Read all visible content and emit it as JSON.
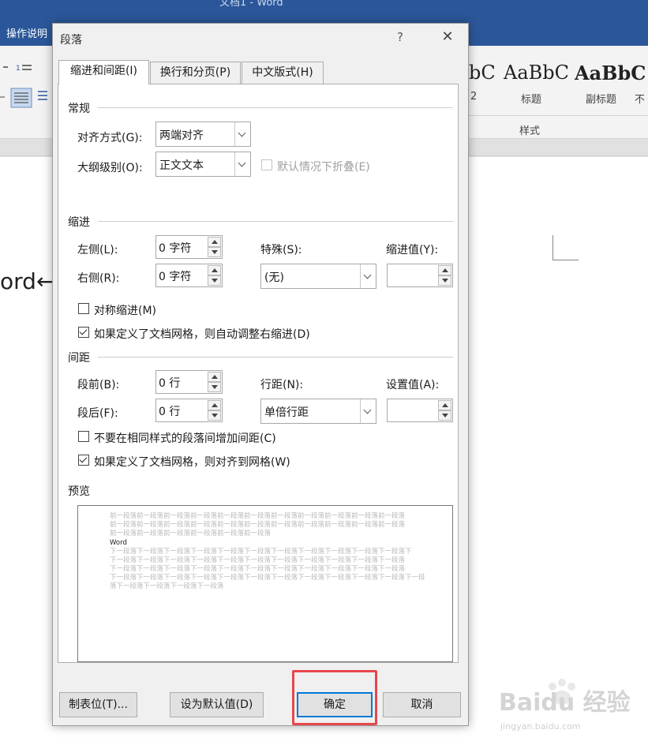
{
  "word": {
    "title_partial": "文档1 - Word",
    "tellme": "操作说明",
    "styles": [
      {
        "sample": "bC",
        "label": "2"
      },
      {
        "sample": "AaBbC",
        "label": "标题"
      },
      {
        "sample": "AaBbC",
        "label": "副标题"
      },
      {
        "sample": "",
        "label": "不"
      }
    ],
    "styles_group_label": "样式",
    "document_text": "ord←"
  },
  "dialog": {
    "title": "段落",
    "help": "?",
    "close": "✕",
    "tabs": [
      {
        "label": "缩进和间距(I)",
        "active": true
      },
      {
        "label": "换行和分页(P)",
        "active": false
      },
      {
        "label": "中文版式(H)",
        "active": false
      }
    ],
    "general": {
      "section": "常规",
      "alignment_label": "对齐方式(G):",
      "alignment_value": "两端对齐",
      "outline_label": "大纲级别(O):",
      "outline_value": "正文文本",
      "collapse_label": "默认情况下折叠(E)"
    },
    "indent": {
      "section": "缩进",
      "left_label": "左侧(L):",
      "left_value": "0 字符",
      "right_label": "右侧(R):",
      "right_value": "0 字符",
      "special_label": "特殊(S):",
      "special_value": "(无)",
      "by_label": "缩进值(Y):",
      "by_value": "",
      "mirror_label": "对称缩进(M)",
      "mirror_checked": false,
      "auto_adjust_label": "如果定义了文档网格，则自动调整右缩进(D)",
      "auto_adjust_checked": true
    },
    "spacing": {
      "section": "间距",
      "before_label": "段前(B):",
      "before_value": "0 行",
      "after_label": "段后(F):",
      "after_value": "0 行",
      "line_label": "行距(N):",
      "line_value": "单倍行距",
      "at_label": "设置值(A):",
      "at_value": "",
      "no_space_label": "不要在相同样式的段落间增加间距(C)",
      "no_space_checked": false,
      "snap_grid_label": "如果定义了文档网格，则对齐到网格(W)",
      "snap_grid_checked": true
    },
    "preview": {
      "section": "预览",
      "prev_lines": [
        "前一段落前一段落前一段落前一段落前一段落前一段落前一段落前一段落前一段落前一段落前一段落",
        "前一段落前一段落前一段落前一段落前一段落前一段落前一段落前一段落前一段落前一段落前一段落",
        "前一段落前一段落前一段落前一段落前一段落前一段落"
      ],
      "current": "Word",
      "next_lines": [
        "下一段落下一段落下一段落下一段落下一段落下一段落下一段落下一段落下一段落下一段落下一段落下",
        "下一段落下一段落下一段落下一段落下一段落下一段落下一段落下一段落下一段落下一段落下一段落",
        "下一段落下一段落下一段落下一段落下一段落下一段落下一段落下一段落下一段落下一段落下一段落",
        "下一段落下一段落下一段落下一段落下一段落下一段落下一段落下一段落下一段落下一段落下一段落下一段",
        "落下一段落下一段落下一段落下一段落"
      ]
    },
    "buttons": {
      "tabs": "制表位(T)...",
      "set_default": "设为默认值(D)",
      "ok": "确定",
      "cancel": "取消"
    }
  },
  "watermark": {
    "brand": "Baidu 经验",
    "url": "jingyan.baidu.com"
  },
  "colors": {
    "word_blue": "#2b579a",
    "annotation_red": "#e8474d",
    "focus_blue": "#0078d7"
  }
}
